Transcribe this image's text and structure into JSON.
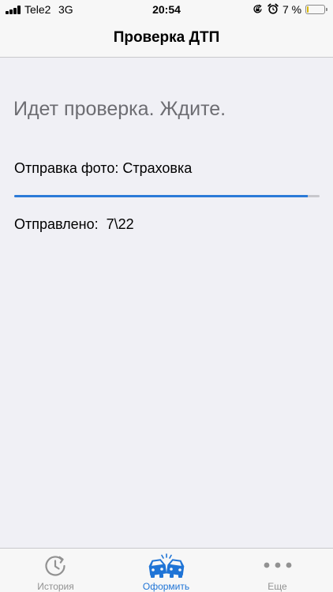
{
  "status_bar": {
    "carrier": "Tele2",
    "network": "3G",
    "time": "20:54",
    "battery_percent_text": "7 %",
    "battery_level": 0.07,
    "icons": [
      "signal-bars-icon",
      "orientation-lock-icon",
      "alarm-icon",
      "battery-icon"
    ]
  },
  "nav": {
    "title": "Проверка ДТП"
  },
  "main": {
    "status_text": "Идет проверка. Ждите.",
    "upload_label": "Отправка фото: Страховка",
    "progress": 0.96,
    "sent_label": "Отправлено:  ",
    "sent_value": "7\\22"
  },
  "tabs": [
    {
      "label": "История",
      "icon": "history-clock-icon",
      "active": false
    },
    {
      "label": "Оформить",
      "icon": "car-crash-icon",
      "active": true
    },
    {
      "label": "Еще",
      "icon": "more-dots-icon",
      "active": false
    }
  ],
  "colors": {
    "accent": "#1f74d6",
    "progress": "#2b7ad8",
    "inactive_tab": "#929292",
    "background": "#f0f0f5"
  }
}
